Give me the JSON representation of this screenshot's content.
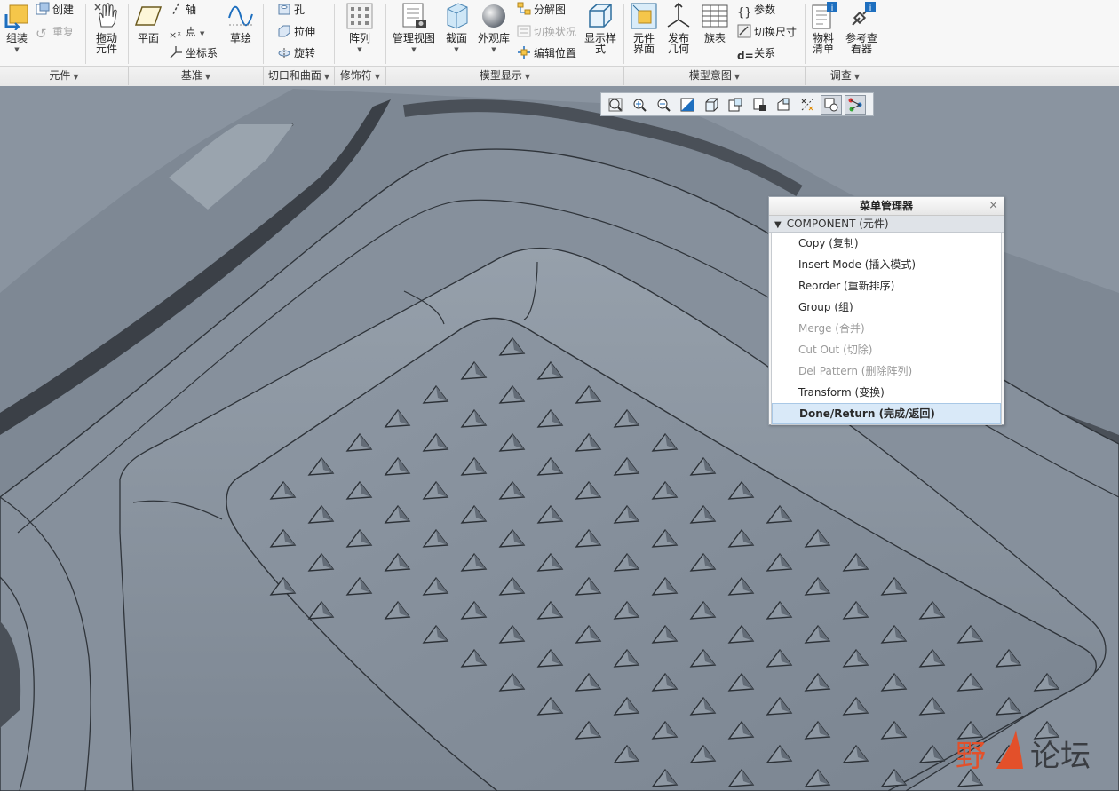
{
  "ribbon": {
    "groups": [
      {
        "label": "元件"
      },
      {
        "label": "基准"
      },
      {
        "label": "切口和曲面"
      },
      {
        "label": "修饰符"
      },
      {
        "label": "模型显示"
      },
      {
        "label": "模型意图"
      },
      {
        "label": "调查"
      }
    ],
    "buttons": {
      "assemble": "组装",
      "create": "创建",
      "repeat": "重复",
      "drag_components": "拖动\n元件",
      "plane": "平面",
      "axis": "轴",
      "point": "点",
      "csys": "坐标系",
      "sketch": "草绘",
      "hole": "孔",
      "extrude": "拉伸",
      "revolve": "旋转",
      "pattern": "阵列",
      "view_manager": "管理视图",
      "section": "截面",
      "appearance": "外观库",
      "exploded_view": "分解图",
      "toggle_status": "切换状况",
      "edit_position": "编辑位置",
      "display_style": "显示样\n式",
      "component_interface": "元件\n界面",
      "publish_geometry": "发布\n几何",
      "family_table": "族表",
      "parameters": "参数",
      "switch_dimensions": "切换尺寸",
      "relations": "关系",
      "bill_of_materials": "物料\n清单",
      "reference_viewer": "参考查\n看器"
    }
  },
  "menu_manager": {
    "title": "菜单管理器",
    "section": "COMPONENT (元件)",
    "items": [
      {
        "label": "Copy (复制)",
        "enabled": true
      },
      {
        "label": "Insert Mode (插入模式)",
        "enabled": true
      },
      {
        "label": "Reorder (重新排序)",
        "enabled": true
      },
      {
        "label": "Group (组)",
        "enabled": true
      },
      {
        "label": "Merge (合并)",
        "enabled": false
      },
      {
        "label": "Cut Out (切除)",
        "enabled": false
      },
      {
        "label": "Del Pattern (删除阵列)",
        "enabled": false
      },
      {
        "label": "Transform (变换)",
        "enabled": true
      },
      {
        "label": "Done/Return (完成/返回)",
        "enabled": true,
        "selected": true
      }
    ]
  },
  "watermark": {
    "text_a": "野",
    "text_b": "论坛"
  },
  "colors": {
    "model": "#7d8794",
    "accent": "#1e6fbf",
    "watermark": "#e3502a"
  }
}
